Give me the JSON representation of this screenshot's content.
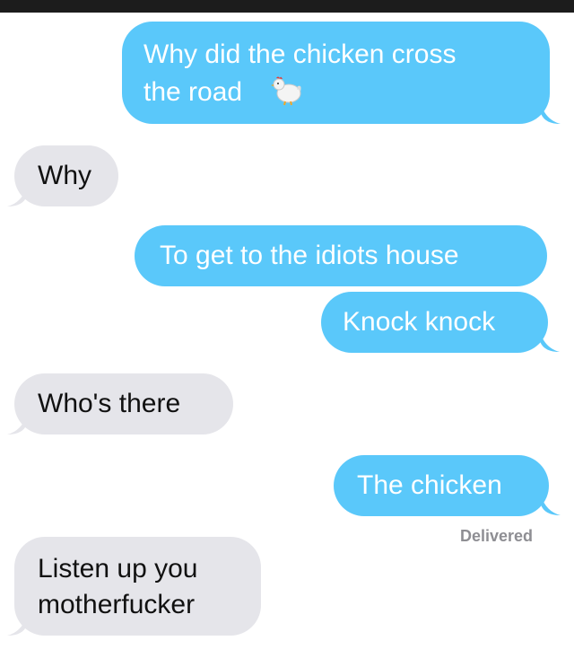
{
  "messages": [
    {
      "side": "sent",
      "lines": [
        "Why did the chicken cross",
        "the road"
      ],
      "emoji": "chicken"
    },
    {
      "side": "received",
      "lines": [
        "Why"
      ]
    },
    {
      "side": "sent",
      "lines": [
        "To get to the idiots house"
      ]
    },
    {
      "side": "sent",
      "lines": [
        "Knock knock"
      ]
    },
    {
      "side": "received",
      "lines": [
        "Who's there"
      ]
    },
    {
      "side": "sent",
      "lines": [
        "The chicken"
      ]
    },
    {
      "side": "received",
      "lines": [
        "Listen up you",
        "motherfucker"
      ]
    }
  ],
  "status": {
    "delivered": "Delivered"
  },
  "colors": {
    "sent_bubble": "#5ac8fa",
    "received_bubble": "#e5e5ea",
    "sent_text": "#ffffff",
    "received_text": "#111111"
  },
  "icons": {
    "emoji": "chicken-emoji-icon"
  }
}
